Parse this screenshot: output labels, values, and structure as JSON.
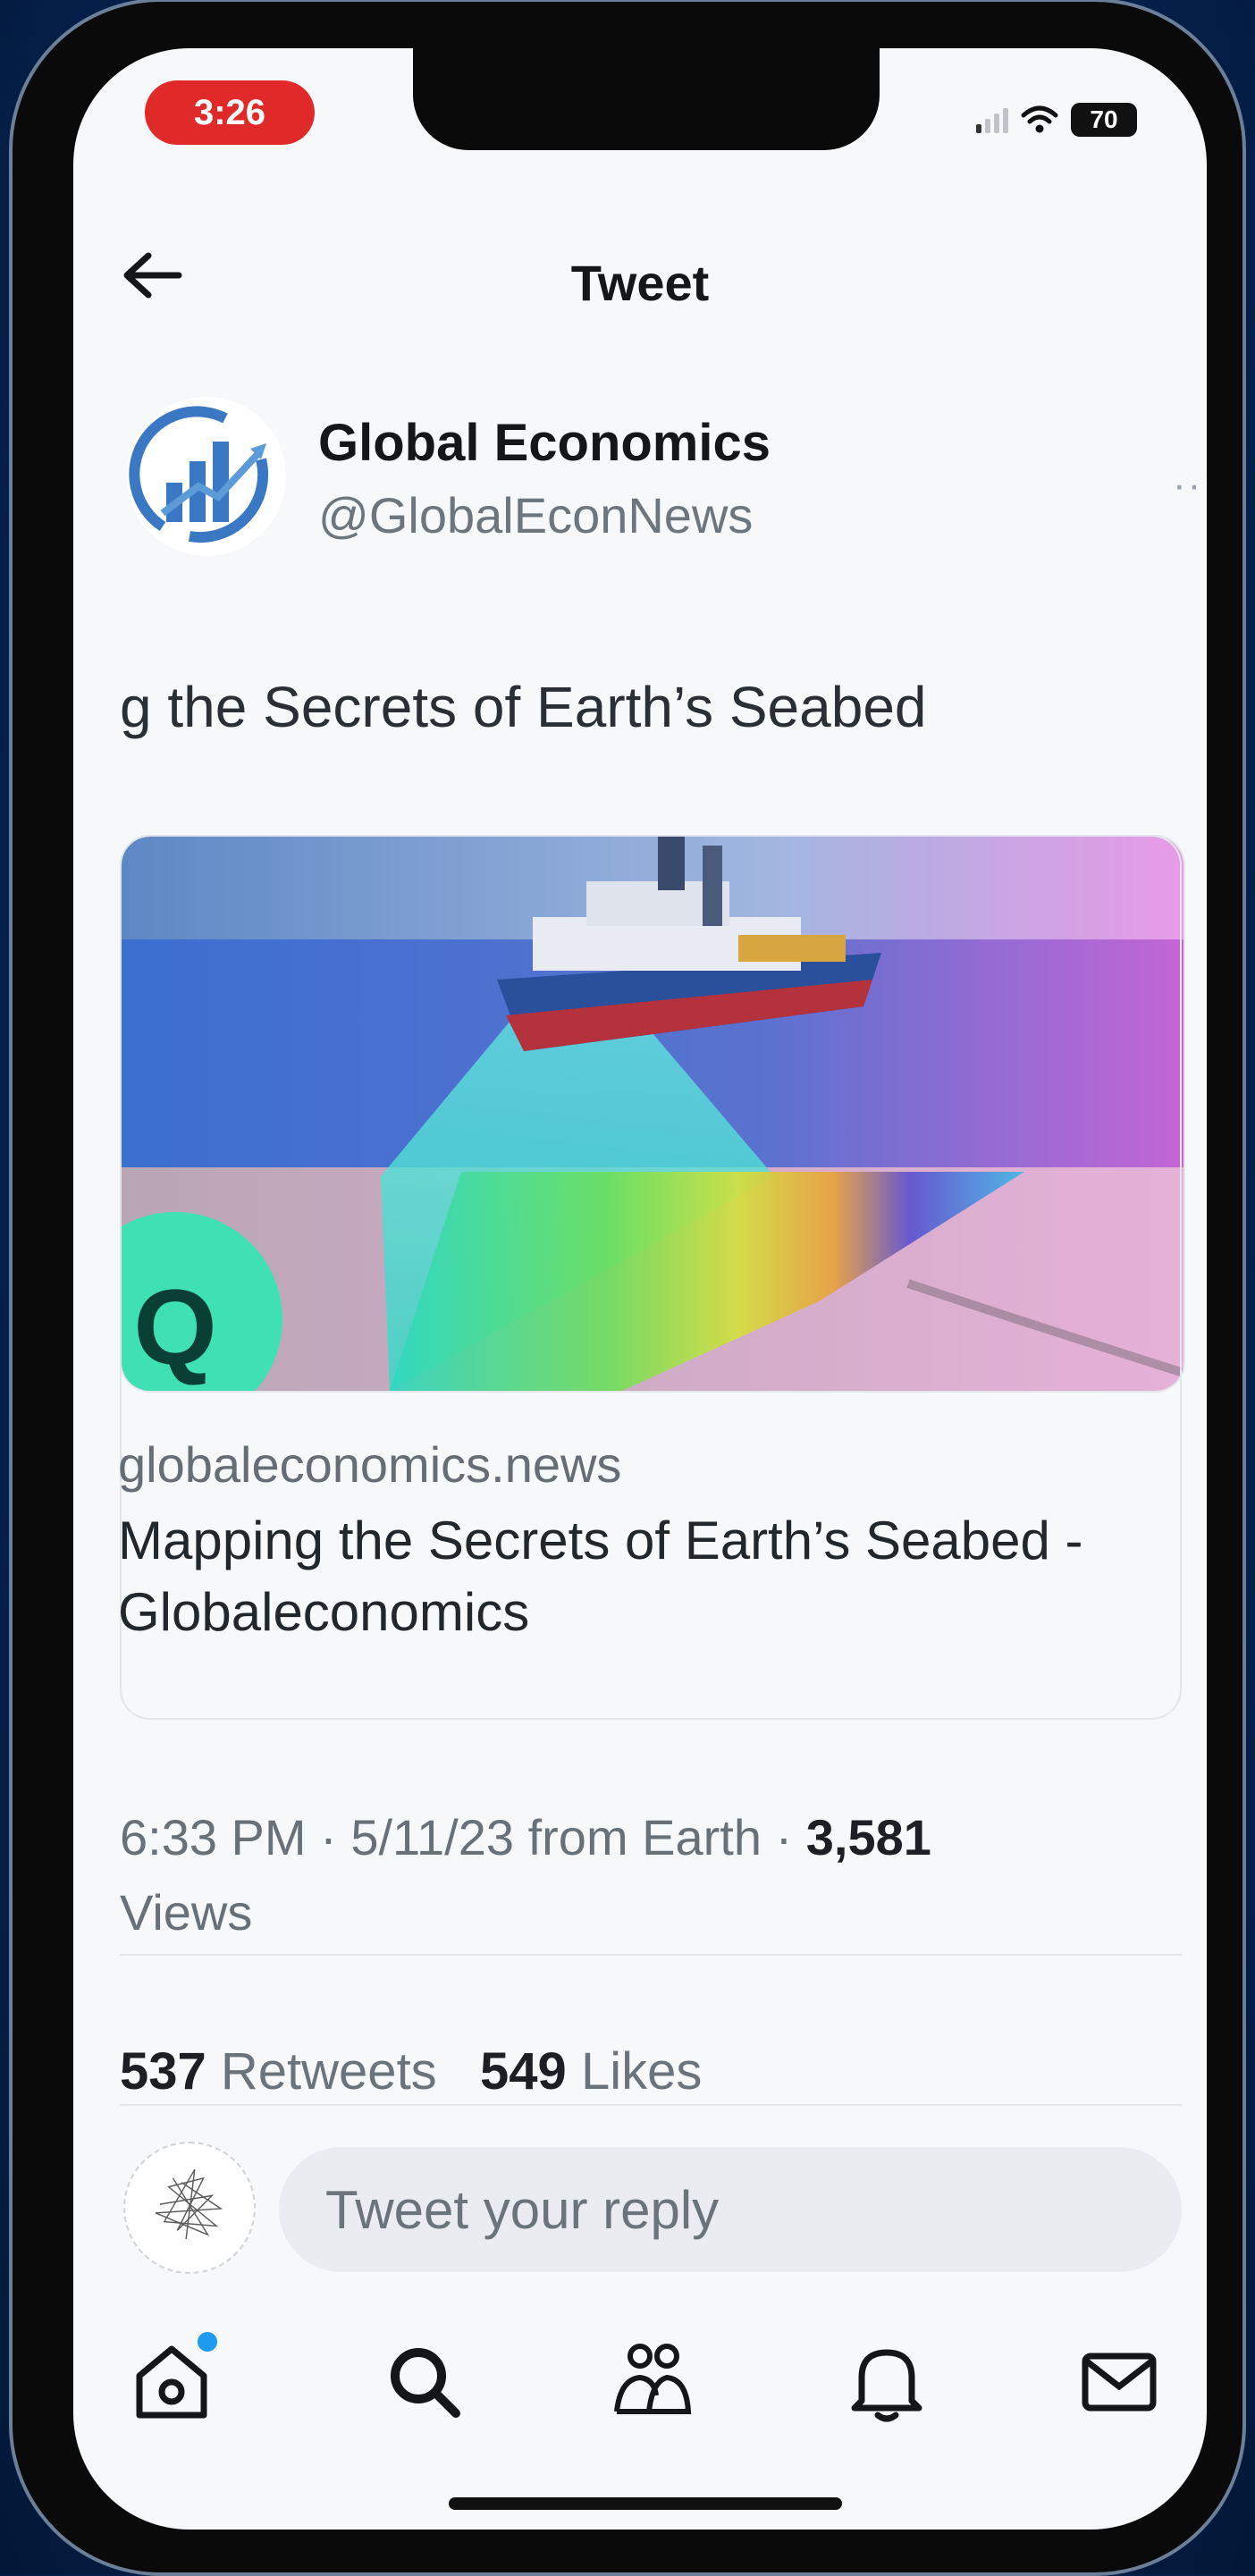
{
  "status_bar": {
    "time": "3:26",
    "battery": "70"
  },
  "header": {
    "title": "Tweet"
  },
  "author": {
    "name": "Global Economics",
    "handle": "@GlobalEconNews",
    "more": "···"
  },
  "tweet": {
    "text": "g the Secrets of Earth’s Seabed"
  },
  "card": {
    "site": "globaleconomics.news",
    "title": "Mapping the Secrets of Earth’s Seabed - Globaleconomics",
    "badge": "Q"
  },
  "meta": {
    "time": "6:33 PM",
    "date": "5/11/23",
    "source": "from Earth",
    "views_count": "3,581",
    "views_label": "Views"
  },
  "stats": {
    "retweets_count": "537",
    "retweets_label": "Retweets",
    "likes_count": "549",
    "likes_label": "Likes"
  },
  "reply": {
    "placeholder": "Tweet your reply"
  },
  "tabs": [
    "home-icon",
    "search-icon",
    "communities-icon",
    "notifications-icon",
    "messages-icon"
  ],
  "colors": {
    "accent": "#1d9bf0",
    "time_pill": "#e02a2a",
    "logo_blue": "#3b78c4"
  }
}
